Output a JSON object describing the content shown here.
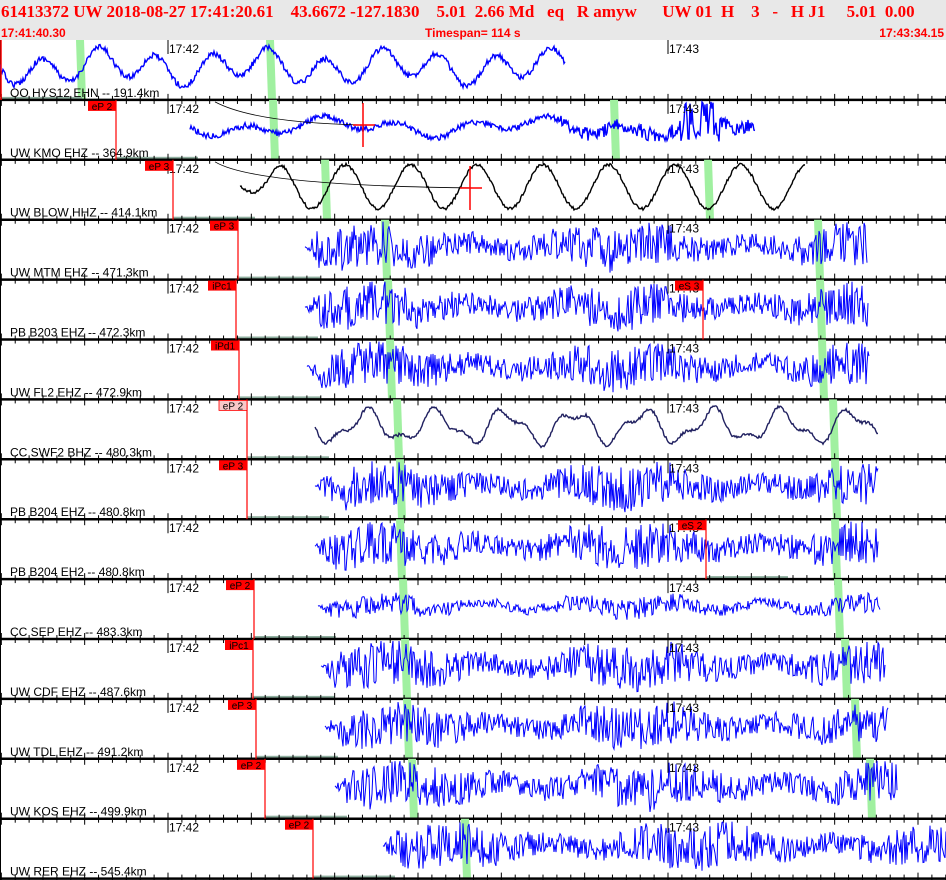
{
  "header": {
    "title": "61413372 UW 2018-08-27 17:41:20.61    43.6672 -127.1830    5.01  2.66 Md   eq   R amyw      UW 01  H    3   -   H J1     5.01  0.00",
    "start_time": "17:41:40.30",
    "timespan": "Timespan= 114 s",
    "end_time": "17:43:34.15"
  },
  "time_labels": [
    "17:42",
    "17:43"
  ],
  "colors": {
    "trace": "#0000ff",
    "broadband": "#000000",
    "long_period": "#202060",
    "pick": "#ff0000",
    "pick_weak": "#f8c8c8",
    "phase_marker": "#a0f0a0",
    "header_text": "#ff0000"
  },
  "rows": [
    {
      "label": "OO HYS12 EHN -- 191.4km",
      "picks": []
    },
    {
      "label": "UW KMO EHZ -- 364.9km",
      "picks": [
        {
          "label": "eP 2"
        }
      ]
    },
    {
      "label": "UW BLOW HHZ -- 414.1km",
      "picks": [
        {
          "label": "eP 3"
        }
      ]
    },
    {
      "label": "UW MTM EHZ -- 471.3km",
      "picks": [
        {
          "label": "eP 3"
        }
      ]
    },
    {
      "label": "PB B203 EHZ -- 472.3km",
      "picks": [
        {
          "label": "iPc1"
        },
        {
          "label": "eS 3"
        }
      ]
    },
    {
      "label": "UW FL2 EHZ -- 472.9km",
      "picks": [
        {
          "label": "iPd1"
        }
      ]
    },
    {
      "label": "CC SWF2 BHZ -- 480.3km",
      "picks": [
        {
          "label": "eP 2"
        }
      ]
    },
    {
      "label": "PB B204 EHZ -- 480.8km",
      "picks": [
        {
          "label": "eP 3"
        }
      ]
    },
    {
      "label": "PB B204 EH2 -- 480.8km",
      "picks": [
        {
          "label": "eS 2"
        }
      ]
    },
    {
      "label": "CC SEP EHZ -- 483.3km",
      "picks": [
        {
          "label": "eP 2"
        }
      ]
    },
    {
      "label": "UW CDF EHZ -- 487.6km",
      "picks": [
        {
          "label": "iPc1"
        }
      ]
    },
    {
      "label": "UW TDL EHZ -- 491.2km",
      "picks": [
        {
          "label": "eP 3"
        }
      ]
    },
    {
      "label": "UW KOS EHZ -- 499.9km",
      "picks": [
        {
          "label": "eP 2"
        }
      ]
    },
    {
      "label": "UW RER EHZ -- 545.4km",
      "picks": [
        {
          "label": "eP 2"
        }
      ]
    }
  ]
}
